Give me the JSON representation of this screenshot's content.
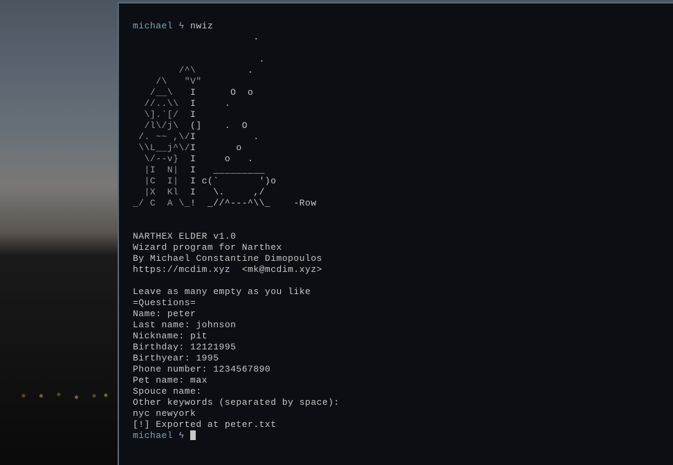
{
  "prompt1": {
    "user": "michael",
    "symbol": "ϟ",
    "command": "nwiz"
  },
  "ascii_art": {
    "line1": "                     .",
    "line2": "",
    "line3": "                      .",
    "line4_dim": "        /^\\",
    "line4_main": "         .",
    "line5_dim": "    /\\   \"V\"",
    "line6_dim": "   /__\\   ",
    "line6_main": "I      O  o",
    "line7_dim": "  //..\\\\  ",
    "line7_main": "I     .",
    "line8_dim": "  \\].`[/  ",
    "line8_main": "I",
    "line9_dim": "  /l\\/j\\  ",
    "line9_main": "(]    .  O",
    "line10_dim": " /. ~~ ,\\/",
    "line10_main": "I          .",
    "line11_dim": " \\\\L__j^\\/",
    "line11_main": "I       o",
    "line12_dim": "  \\/--v}  ",
    "line12_main": "I     o   .",
    "line13_dim": "  |I  N|  ",
    "line13_main": "I   _________",
    "line14_dim": "  |C  I|  ",
    "line14_main": "I c(`       ')o",
    "line15_dim": "  |X  Kl  ",
    "line15_main": "I   \\.     ,/",
    "line16_dim": "_/ C  A \\_",
    "line16_main": "!  _//^---^\\\\_    -Row"
  },
  "header": {
    "title": "NARTHEX ELDER v1.0",
    "description": "Wizard program for Narthex",
    "author": "By Michael Constantine Dimopoulos",
    "url_line": "https://mcdim.xyz  <mk@mcdim.xyz>"
  },
  "instructions": "Leave as many empty as you like",
  "questions_header": "=Questions=",
  "questions": {
    "name": {
      "label": "Name: ",
      "value": "peter"
    },
    "lastname": {
      "label": "Last name: ",
      "value": "johnson"
    },
    "nickname": {
      "label": "Nickname: ",
      "value": "pit"
    },
    "birthday": {
      "label": "Birthday: ",
      "value": "12121995"
    },
    "birthyear": {
      "label": "Birthyear: ",
      "value": "1995"
    },
    "phone": {
      "label": "Phone number: ",
      "value": "1234567890"
    },
    "pet": {
      "label": "Pet name: ",
      "value": "max"
    },
    "spouse": {
      "label": "Spouce name:",
      "value": ""
    },
    "keywords_label": "Other keywords (separated by space):",
    "keywords_value": "nyc newyork"
  },
  "export_msg": "[!] Exported at peter.txt",
  "prompt2": {
    "user": "michael",
    "symbol": "ϟ"
  }
}
